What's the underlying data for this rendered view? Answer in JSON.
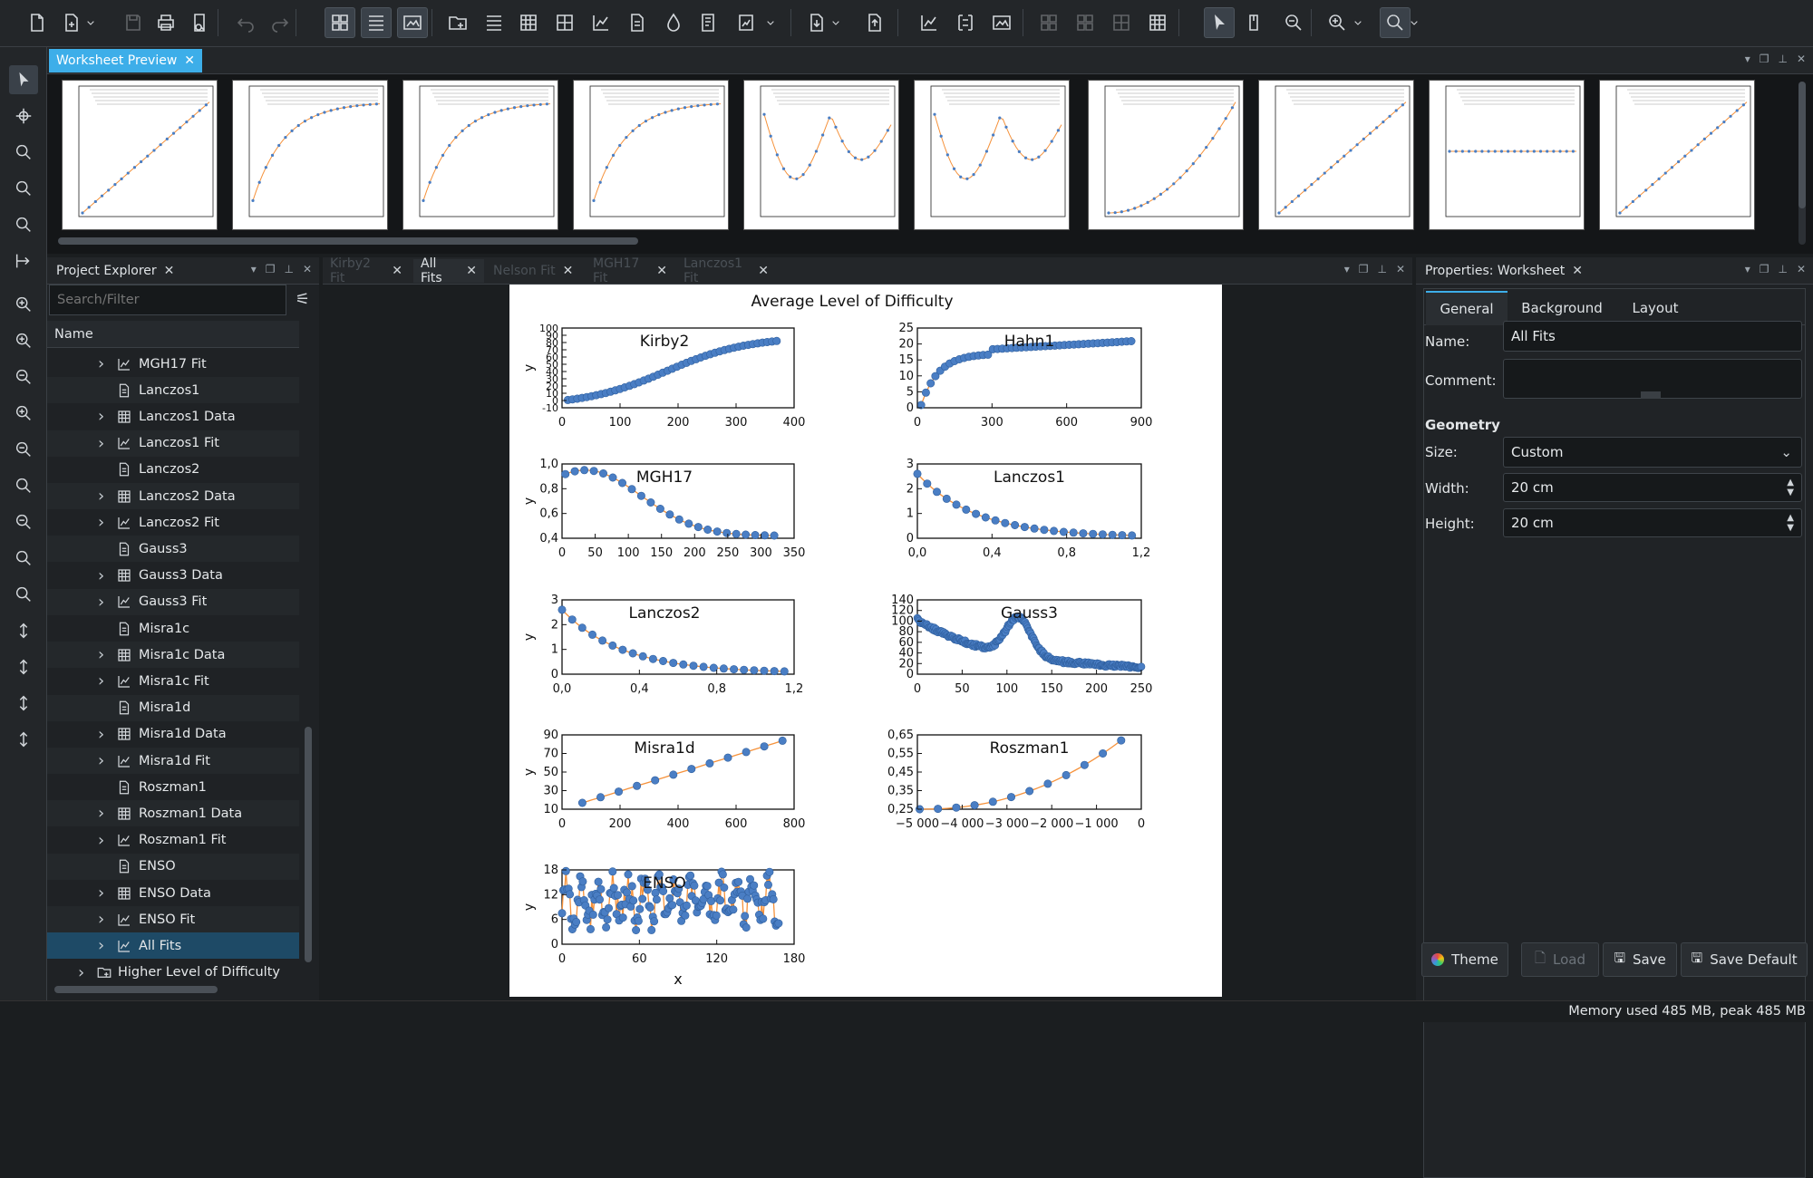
{
  "toolbar": {
    "icons": [
      "new-project-icon",
      "new-worksheet-icon",
      "dropdown-icon",
      "save-icon",
      "print-icon",
      "print-preview-icon",
      "undo-icon",
      "redo-icon",
      "layout-icon",
      "list-icon",
      "image-icon",
      "folder-icon",
      "spreadsheet-icon",
      "matrix-icon",
      "table-icon",
      "plot-icon",
      "note-icon",
      "datapicker-icon",
      "notebook-icon",
      "worksheet-icon",
      "import-icon",
      "export-icon",
      "cursor-icon",
      "mouse-icon",
      "zoom-fit-icon",
      "zoom-in-icon",
      "zoom-select-icon"
    ]
  },
  "preview": {
    "tab_label": "Worksheet Preview"
  },
  "explorer": {
    "tab_label": "Project Explorer",
    "search_placeholder": "Search/Filter",
    "column_header": "Name",
    "items": [
      {
        "label": "MGH17 Fit",
        "kind": "fit",
        "chev": true
      },
      {
        "label": "Lanczos1",
        "kind": "note",
        "chev": false
      },
      {
        "label": "Lanczos1 Data",
        "kind": "spreadsheet",
        "chev": true
      },
      {
        "label": "Lanczos1 Fit",
        "kind": "fit",
        "chev": true
      },
      {
        "label": "Lanczos2",
        "kind": "note",
        "chev": false
      },
      {
        "label": "Lanczos2 Data",
        "kind": "spreadsheet",
        "chev": true
      },
      {
        "label": "Lanczos2 Fit",
        "kind": "fit",
        "chev": true
      },
      {
        "label": "Gauss3",
        "kind": "note",
        "chev": false
      },
      {
        "label": "Gauss3 Data",
        "kind": "spreadsheet",
        "chev": true
      },
      {
        "label": "Gauss3 Fit",
        "kind": "fit",
        "chev": true
      },
      {
        "label": "Misra1c",
        "kind": "note",
        "chev": false
      },
      {
        "label": "Misra1c Data",
        "kind": "spreadsheet",
        "chev": true
      },
      {
        "label": "Misra1c Fit",
        "kind": "fit",
        "chev": true
      },
      {
        "label": "Misra1d",
        "kind": "note",
        "chev": false
      },
      {
        "label": "Misra1d Data",
        "kind": "spreadsheet",
        "chev": true
      },
      {
        "label": "Misra1d Fit",
        "kind": "fit",
        "chev": true
      },
      {
        "label": "Roszman1",
        "kind": "note",
        "chev": false
      },
      {
        "label": "Roszman1 Data",
        "kind": "spreadsheet",
        "chev": true
      },
      {
        "label": "Roszman1 Fit",
        "kind": "fit",
        "chev": true
      },
      {
        "label": "ENSO",
        "kind": "note",
        "chev": false
      },
      {
        "label": "ENSO Data",
        "kind": "spreadsheet",
        "chev": true
      },
      {
        "label": "ENSO Fit",
        "kind": "fit",
        "chev": true
      },
      {
        "label": "All Fits",
        "kind": "worksheet",
        "chev": true,
        "selected": true
      }
    ],
    "folder": "Higher Level of Difficulty"
  },
  "doc_tabs": [
    {
      "label": "Kirby2 Fit",
      "active": false
    },
    {
      "label": "All Fits",
      "active": true
    },
    {
      "label": "Nelson Fit",
      "active": false
    },
    {
      "label": "MGH17 Fit",
      "active": false
    },
    {
      "label": "Lanczos1 Fit",
      "active": false
    }
  ],
  "worksheet": {
    "title": "Average Level of Difficulty"
  },
  "chart_data": [
    {
      "type": "scatter",
      "title": "Kirby2",
      "ylabel": "y",
      "xlim": [
        0,
        400
      ],
      "ylim": [
        -10,
        100
      ],
      "xticks": [
        "0",
        "100",
        "200",
        "300",
        "400"
      ],
      "yticks": [
        "100",
        "90",
        "80",
        "70",
        "60",
        "50",
        "40",
        "30",
        "20",
        "10",
        "0",
        "-10"
      ]
    },
    {
      "type": "scatter",
      "title": "Hahn1",
      "xlim": [
        0,
        900
      ],
      "ylim": [
        0,
        25
      ],
      "xticks": [
        "0",
        "300",
        "600",
        "900"
      ],
      "yticks": [
        "25",
        "20",
        "15",
        "10",
        "5",
        "0"
      ]
    },
    {
      "type": "scatter",
      "title": "MGH17",
      "ylabel": "y",
      "xlim": [
        0,
        350
      ],
      "ylim": [
        0.4,
        1.0
      ],
      "xticks": [
        "0",
        "50",
        "100",
        "150",
        "200",
        "250",
        "300",
        "350"
      ],
      "yticks": [
        "1,0",
        "0,8",
        "0,6",
        "0,4"
      ]
    },
    {
      "type": "scatter",
      "title": "Lanczos1",
      "xlim": [
        0,
        1.2
      ],
      "ylim": [
        0,
        3
      ],
      "xticks": [
        "0,0",
        "0,4",
        "0,8",
        "1,2"
      ],
      "yticks": [
        "3",
        "2",
        "1",
        "0"
      ]
    },
    {
      "type": "scatter",
      "title": "Lanczos2",
      "ylabel": "y",
      "xlim": [
        0,
        1.2
      ],
      "ylim": [
        0,
        3
      ],
      "xticks": [
        "0,0",
        "0,4",
        "0,8",
        "1,2"
      ],
      "yticks": [
        "3",
        "2",
        "1",
        "0"
      ]
    },
    {
      "type": "scatter",
      "title": "Gauss3",
      "xlim": [
        0,
        250
      ],
      "ylim": [
        0,
        140
      ],
      "xticks": [
        "0",
        "50",
        "100",
        "150",
        "200",
        "250"
      ],
      "yticks": [
        "140",
        "120",
        "100",
        "80",
        "60",
        "40",
        "20",
        "0"
      ]
    },
    {
      "type": "scatter",
      "title": "Misra1d",
      "ylabel": "y",
      "xlim": [
        0,
        800
      ],
      "ylim": [
        10,
        90
      ],
      "xticks": [
        "0",
        "200",
        "400",
        "600",
        "800"
      ],
      "yticks": [
        "90",
        "70",
        "50",
        "30",
        "10"
      ]
    },
    {
      "type": "scatter",
      "title": "Roszman1",
      "xlim": [
        -5000,
        0
      ],
      "ylim": [
        0.25,
        0.65
      ],
      "xticks": [
        "−5 000",
        "−4 000",
        "−3 000",
        "−2 000",
        "−1 000",
        "0"
      ],
      "yticks": [
        "0,65",
        "0,55",
        "0,45",
        "0,35",
        "0,25"
      ]
    },
    {
      "type": "scatter",
      "title": "ENSO",
      "ylabel": "y",
      "xlabel": "x",
      "xlim": [
        0,
        180
      ],
      "ylim": [
        0,
        18
      ],
      "xticks": [
        "0",
        "60",
        "120",
        "180"
      ],
      "yticks": [
        "18",
        "12",
        "6",
        "0"
      ]
    }
  ],
  "props": {
    "tab_label": "Properties: Worksheet",
    "tabs": [
      "General",
      "Background",
      "Layout"
    ],
    "name_label": "Name:",
    "name_value": "All Fits",
    "comment_label": "Comment:",
    "geometry_header": "Geometry",
    "size_label": "Size:",
    "size_value": "Custom",
    "width_label": "Width:",
    "width_value": "20 cm",
    "height_label": "Height:",
    "height_value": "20 cm",
    "buttons": {
      "theme": "Theme",
      "load": "Load",
      "save": "Save",
      "save_default": "Save Default"
    }
  },
  "status": {
    "memory": "Memory used 485 MB, peak 485 MB"
  },
  "colors": {
    "accent": "#3daee9",
    "point": "#4a7ec4",
    "fit": "#f5913a",
    "selection": "#1e4a66"
  }
}
